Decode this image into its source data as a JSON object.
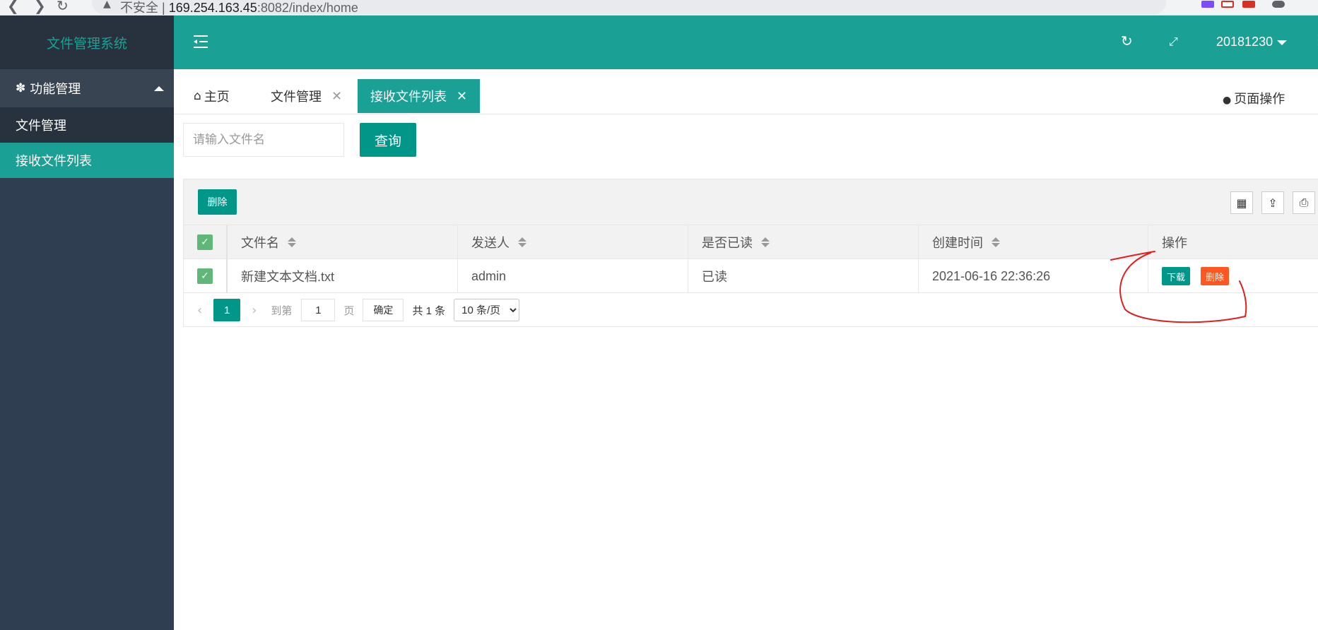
{
  "browser": {
    "back": "❮",
    "forward": "❯",
    "reload": "↻",
    "security": "不安全",
    "url_host": "169.254.163.45",
    "url_path": ":8082/index/home"
  },
  "sidebar": {
    "logo": "文件管理系统",
    "group": "功能管理",
    "items": [
      {
        "label": "文件管理"
      },
      {
        "label": "接收文件列表"
      }
    ]
  },
  "header": {
    "user": "20181230"
  },
  "tabs": [
    {
      "label": "主页"
    },
    {
      "label": "文件管理"
    },
    {
      "label": "接收文件列表"
    }
  ],
  "page_ops": "页面操作",
  "search": {
    "placeholder": "请输入文件名",
    "button": "查询"
  },
  "table": {
    "delete_label": "删除",
    "columns": [
      "文件名",
      "发送人",
      "是否已读",
      "创建时间",
      "操作"
    ],
    "rows": [
      {
        "file": "新建文本文档.txt",
        "sender": "admin",
        "read": "已读",
        "created": "2021-06-16 22:36:26",
        "download": "下载",
        "delete": "删除"
      }
    ]
  },
  "pager": {
    "current": "1",
    "goto_label": "到第",
    "page_value": "1",
    "page_unit": "页",
    "confirm": "确定",
    "total": "共 1 条",
    "per_page": "10 条/页"
  },
  "colors": {
    "brand": "#1aa094",
    "primary": "#009688",
    "danger": "#ff5722",
    "sidebar": "#2f3e50",
    "annotation": "#e02020"
  }
}
